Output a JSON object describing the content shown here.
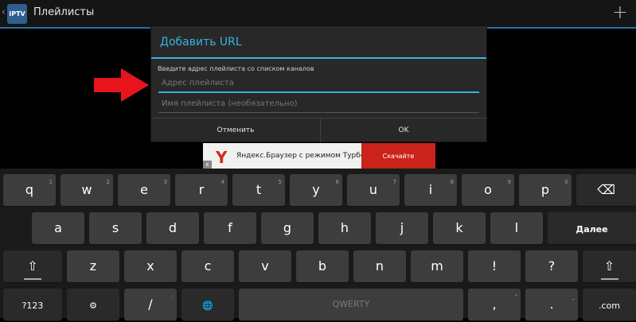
{
  "actionbar": {
    "back_glyph": "‹",
    "app_icon_text": "IPTV",
    "title": "Плейлисты",
    "add_glyph": "+"
  },
  "dialog": {
    "title": "Добавить URL",
    "hint": "Введите адрес плейлиста со списком каналов",
    "url_field": {
      "value": "",
      "placeholder": "Адрес плейлиста"
    },
    "name_field": {
      "value": "",
      "placeholder": "Имя плейлиста (необязательно)"
    },
    "cancel_label": "Отменить",
    "ok_label": "OK"
  },
  "ad": {
    "logo": "Y",
    "text": "Яндекс.Браузер с режимом Турбо",
    "button": "Скачайте",
    "close": "x"
  },
  "keyboard": {
    "row1": [
      {
        "label": "q",
        "hint": "1"
      },
      {
        "label": "w",
        "hint": "2"
      },
      {
        "label": "e",
        "hint": "3"
      },
      {
        "label": "r",
        "hint": "4"
      },
      {
        "label": "t",
        "hint": "5"
      },
      {
        "label": "y",
        "hint": "6"
      },
      {
        "label": "u",
        "hint": "7"
      },
      {
        "label": "i",
        "hint": "8"
      },
      {
        "label": "o",
        "hint": "9"
      },
      {
        "label": "p",
        "hint": "0"
      }
    ],
    "row2": [
      {
        "label": "a"
      },
      {
        "label": "s"
      },
      {
        "label": "d"
      },
      {
        "label": "f"
      },
      {
        "label": "g"
      },
      {
        "label": "h"
      },
      {
        "label": "j"
      },
      {
        "label": "k"
      },
      {
        "label": "l"
      }
    ],
    "row3": [
      {
        "label": "z"
      },
      {
        "label": "x"
      },
      {
        "label": "c"
      },
      {
        "label": "v"
      },
      {
        "label": "b"
      },
      {
        "label": "n"
      },
      {
        "label": "m"
      },
      {
        "label": "!"
      },
      {
        "label": "?"
      }
    ],
    "backspace_glyph": "⌫",
    "enter_label": "Далее",
    "shift_glyph": "⇧",
    "symbols_label": "?123",
    "settings_glyph": "⚙",
    "slash_label": "/",
    "slash_hint": ":",
    "globe_glyph": "🌐",
    "space_label": "QWERTY",
    "comma_label": ",",
    "comma_hint": "\"",
    "period_label": ".",
    "period_hint": "_",
    "dotcom_label": ".com"
  },
  "colors": {
    "accent": "#33b5e5",
    "arrow": "#e8141c",
    "ad_button": "#c9231c"
  }
}
